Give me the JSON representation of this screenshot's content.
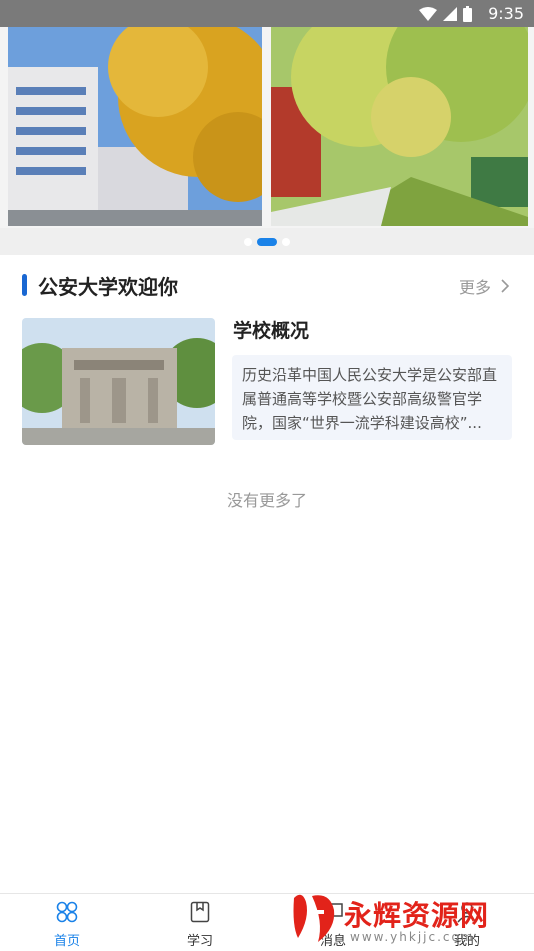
{
  "status_bar": {
    "time": "9:35"
  },
  "banner": {
    "active_slide_index": 1,
    "slide_count": 3
  },
  "section": {
    "title": "公安大学欢迎你",
    "more_label": "更多"
  },
  "article": {
    "title": "学校概况",
    "summary": "历史沿革中国人民公安大学是公安部直属普通高等学校暨公安部高级警官学院，国家“世界一流学科建设高校”..."
  },
  "footer_note": "没有更多了",
  "tabs": [
    {
      "label": "首页",
      "icon": "home-icon",
      "active": true
    },
    {
      "label": "学习",
      "icon": "book-icon",
      "active": false
    },
    {
      "label": "消息",
      "icon": "message-icon",
      "active": false
    },
    {
      "label": "我的",
      "icon": "profile-icon",
      "active": false
    }
  ],
  "watermark": {
    "text": "永辉资源网",
    "url": "www.yhkjjc.com"
  },
  "colors": {
    "accent": "#1a82e8",
    "section_bar": "#1967d2",
    "watermark": "#e2231a"
  }
}
